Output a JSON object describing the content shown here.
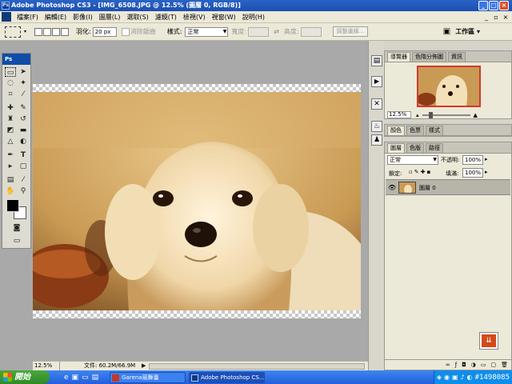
{
  "window": {
    "title": "Adobe Photoshop CS3 - [IMG_6508.JPG @ 12.5% (圖層 0, RGB/8)]",
    "minimize": "_",
    "maximize": "□",
    "close": "×",
    "doc_minimize": "_",
    "doc_restore": "▫",
    "doc_close": "×"
  },
  "menu": {
    "logo": "Ps",
    "items": [
      "檔案(F)",
      "編輯(E)",
      "影像(I)",
      "圖層(L)",
      "選取(S)",
      "濾鏡(T)",
      "檢視(V)",
      "視窗(W)",
      "說明(H)"
    ]
  },
  "options": {
    "feather_label": "羽化:",
    "feather_value": "20 px",
    "antialias_label": "消除鋸齒",
    "style_label": "樣式:",
    "style_value": "正常",
    "width_label": "寬度:",
    "height_label": "高度:",
    "refine_edge": "調整邊緣...",
    "workspace_label": "工作區 ▾"
  },
  "toolbox": {
    "header": "Ps"
  },
  "status": {
    "zoom": "12.5%",
    "doc_info": "文件: 60.2M/66.9M"
  },
  "navigator": {
    "tabs": [
      "導覽器",
      "色階分佈圖",
      "資訊"
    ],
    "zoom": "12.5%"
  },
  "color_panel": {
    "tabs": [
      "顏色",
      "色票",
      "樣式"
    ]
  },
  "layers_panel": {
    "tabs": [
      "圖層",
      "色版",
      "路徑"
    ],
    "blend_mode": "正常",
    "opacity_label": "不透明:",
    "opacity_value": "100%",
    "lock_label": "鎖定:",
    "fill_label": "填滿:",
    "fill_value": "100%",
    "layer_name": "圖層 0"
  },
  "taskbar": {
    "start": "開始",
    "tasks": [
      "Garena競舞臺",
      "Adobe Photoshop CS..."
    ],
    "watermark": "#1498085"
  },
  "colors": {
    "title_blue": "#1c4fb0",
    "panel_grey": "#d6d3c8",
    "canvas_grey": "#a9a9a9",
    "layer_selected": "#b7b4a9",
    "arrow_button": "#d44a1a"
  }
}
